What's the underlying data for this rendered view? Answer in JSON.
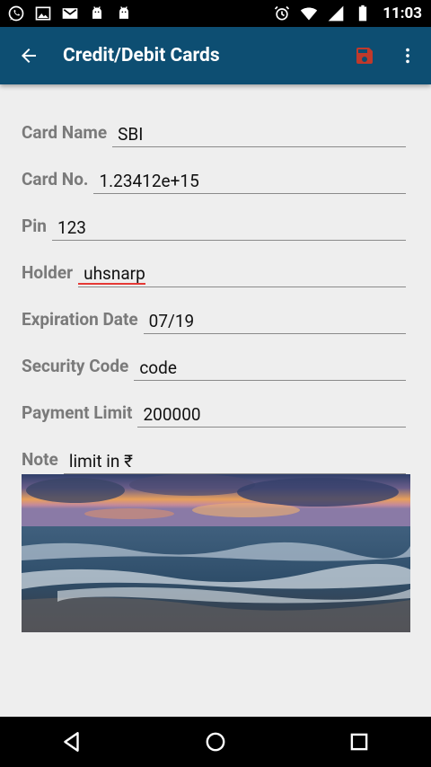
{
  "status_bar": {
    "time": "11:03",
    "left_icons": [
      "whatsapp-icon",
      "image-icon",
      "gmail-icon",
      "android-debug-icon",
      "android-debug-icon"
    ],
    "right_icons": [
      "alarm-icon",
      "wifi-icon",
      "signal-icon",
      "battery-icon"
    ]
  },
  "app_bar": {
    "title": "Credit/Debit Cards",
    "save_color": "#c0392b",
    "background": "#0d4e72"
  },
  "form": {
    "card_name": {
      "label": "Card Name",
      "value": "SBI"
    },
    "card_no": {
      "label": "Card No.",
      "value": "1.23412e+15"
    },
    "pin": {
      "label": "Pin",
      "value": "123"
    },
    "holder": {
      "label": "Holder",
      "value": "uhsnarp"
    },
    "expiration_date": {
      "label": "Expiration Date",
      "value": "07/19"
    },
    "security_code": {
      "label": "Security Code",
      "value": "code"
    },
    "payment_limit": {
      "label": "Payment Limit",
      "value": "200000"
    },
    "note": {
      "label": "Note",
      "value": "limit in ₹"
    }
  },
  "image": {
    "subject": "sea-waves-sunset"
  },
  "nav_bar": {
    "buttons": [
      "back-nav",
      "home-nav",
      "recents-nav"
    ]
  }
}
